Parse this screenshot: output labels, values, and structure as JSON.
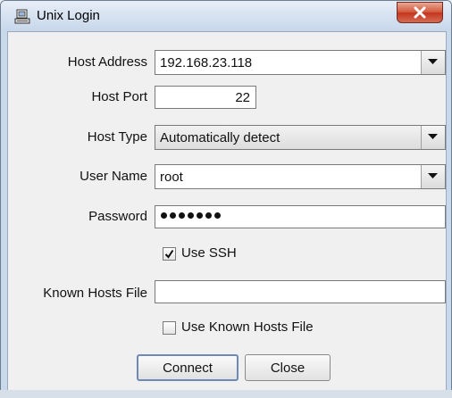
{
  "window": {
    "title": "Unix Login"
  },
  "form": {
    "host_address": {
      "label": "Host Address",
      "value": "192.168.23.118"
    },
    "host_port": {
      "label": "Host Port",
      "value": "22"
    },
    "host_type": {
      "label": "Host Type",
      "value": "Automatically detect"
    },
    "user_name": {
      "label": "User Name",
      "value": "root"
    },
    "password": {
      "label": "Password",
      "masked_length": 7
    },
    "use_ssh": {
      "label": "Use SSH",
      "checked": true
    },
    "known_hosts_file": {
      "label": "Known Hosts File",
      "value": ""
    },
    "use_known_hosts_file": {
      "label": "Use Known Hosts File",
      "checked": false
    }
  },
  "buttons": {
    "connect": "Connect",
    "close": "Close"
  },
  "icons": {
    "app": "login-icon",
    "close": "close-icon",
    "dropdown": "chevron-down-icon",
    "check": "checkmark-icon"
  },
  "colors": {
    "close_button": "#c4351e",
    "default_button_border": "#6e89b5"
  }
}
